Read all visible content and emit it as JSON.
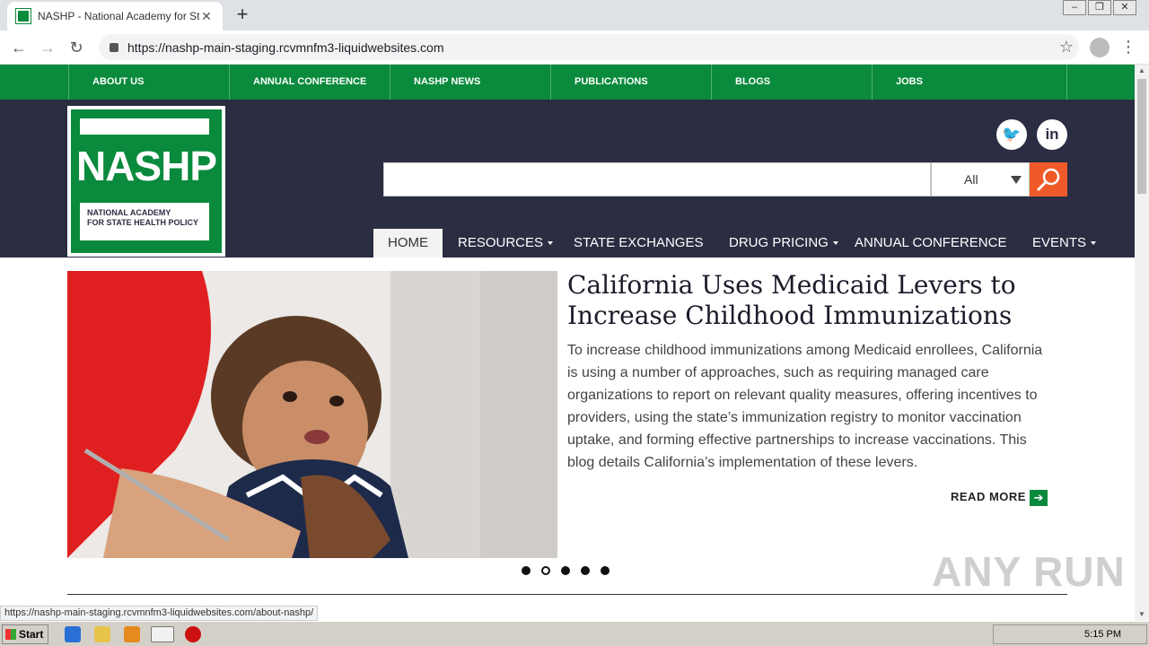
{
  "browser": {
    "tab_title": "NASHP - National Academy for State",
    "tab_close": "✕",
    "new_tab": "+",
    "url": "https://nashp-main-staging.rcvmnfm3-liquidwebsites.com",
    "status_url": "https://nashp-main-staging.rcvmnfm3-liquidwebsites.com/about-nashp/"
  },
  "topnav": {
    "items": [
      "ABOUT US",
      "ANNUAL CONFERENCE",
      "NASHP NEWS",
      "PUBLICATIONS",
      "BLOGS",
      "JOBS"
    ]
  },
  "logo": {
    "name": "NASHP",
    "line1": "NATIONAL ACADEMY",
    "line2": "FOR STATE HEALTH POLICY"
  },
  "social": {
    "twitter_glyph": "🐦",
    "linkedin_glyph": "in"
  },
  "search": {
    "placeholder": "",
    "scope": "All"
  },
  "mainnav": {
    "items": [
      "HOME",
      "RESOURCES",
      "STATE EXCHANGES",
      "DRUG PRICING",
      "ANNUAL CONFERENCE",
      "EVENTS"
    ]
  },
  "hero": {
    "title": "California Uses Medicaid Levers to Increase Childhood Immunizations",
    "body": "To increase childhood immunizations among Medicaid enrollees, California is using a number of approaches, such as requiring managed care organizations to report on relevant quality measures, offering incentives to providers, using the state’s immunization registry to monitor vaccination uptake, and forming effective partnerships to increase vaccinations. This blog details California’s implementation of these levers.",
    "read_more": "READ MORE",
    "read_more_glyph": "➔",
    "slide_count": 5,
    "active_slide": 2
  },
  "watermark": "ANY RUN",
  "taskbar": {
    "start": "Start",
    "clock": "5:15 PM"
  },
  "colors": {
    "green": "#0a8a3c",
    "navy": "#2b2d42",
    "orange": "#f05a28"
  }
}
